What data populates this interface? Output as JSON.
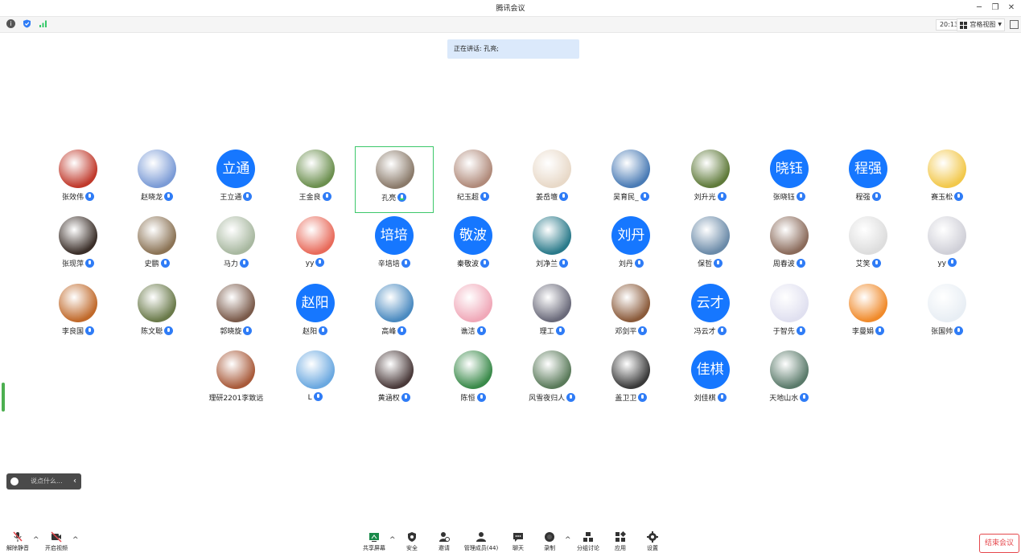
{
  "window": {
    "title": "腾讯会议",
    "timer": "20:13",
    "view_mode": "宫格视图"
  },
  "speaking": {
    "text": "正在讲话: 孔亮;"
  },
  "colors": {
    "accent_blue": "#2f7cf6",
    "active_border": "#3cc86a",
    "end_red": "#e5484d"
  },
  "participants": [
    {
      "name": "张效伟",
      "avatar": "photo",
      "color": "#c0392b"
    },
    {
      "name": "赵晓龙",
      "avatar": "photo",
      "color": "#7b9bd6"
    },
    {
      "name": "王立通",
      "avatar": "text",
      "initials": "立通",
      "color": "#1677ff"
    },
    {
      "name": "王金良",
      "avatar": "photo",
      "color": "#6b8f4e"
    },
    {
      "name": "孔亮",
      "avatar": "photo",
      "color": "#8a7a6a",
      "active": true
    },
    {
      "name": "纪玉超",
      "avatar": "photo",
      "color": "#b08a7a"
    },
    {
      "name": "姜岳壇",
      "avatar": "photo",
      "color": "#e8d9c8"
    },
    {
      "name": "吴育民_",
      "avatar": "photo",
      "color": "#4a7bb5"
    },
    {
      "name": "刘升光",
      "avatar": "photo",
      "color": "#5f7a3a"
    },
    {
      "name": "张晓钰",
      "avatar": "text",
      "initials": "晓钰",
      "color": "#1677ff"
    },
    {
      "name": "程强",
      "avatar": "text",
      "initials": "程强",
      "color": "#1677ff"
    },
    {
      "name": "赛玉松",
      "avatar": "photo",
      "color": "#f2c84b"
    },
    {
      "name": "张现萍",
      "avatar": "photo",
      "color": "#3a2e28"
    },
    {
      "name": "史鹏",
      "avatar": "photo",
      "color": "#8b7355"
    },
    {
      "name": "马力",
      "avatar": "photo",
      "color": "#a8b8a0"
    },
    {
      "name": "yy",
      "avatar": "photo",
      "color": "#e86a5a"
    },
    {
      "name": "辛培培",
      "avatar": "text",
      "initials": "培培",
      "color": "#1677ff"
    },
    {
      "name": "秦敬波",
      "avatar": "text",
      "initials": "敬波",
      "color": "#1677ff"
    },
    {
      "name": "刘净兰",
      "avatar": "photo",
      "color": "#2a7a8a"
    },
    {
      "name": "刘丹",
      "avatar": "text",
      "initials": "刘丹",
      "color": "#1677ff"
    },
    {
      "name": "保哲",
      "avatar": "photo",
      "color": "#6a8aa8"
    },
    {
      "name": "周春波",
      "avatar": "photo",
      "color": "#8a6a5a"
    },
    {
      "name": "艾笑",
      "avatar": "photo",
      "color": "#dddddd"
    },
    {
      "name": "yy",
      "avatar": "photo",
      "color": "#d0d0d8"
    },
    {
      "name": "李良国",
      "avatar": "photo",
      "color": "#c0692a"
    },
    {
      "name": "陈文聪",
      "avatar": "photo",
      "color": "#6a7a4a"
    },
    {
      "name": "郭晓旋",
      "avatar": "photo",
      "color": "#7a5a4a"
    },
    {
      "name": "赵阳",
      "avatar": "text",
      "initials": "赵阳",
      "color": "#1677ff"
    },
    {
      "name": "高峰",
      "avatar": "photo",
      "color": "#4a8ac0"
    },
    {
      "name": "谯洁",
      "avatar": "photo",
      "color": "#f0a8b8"
    },
    {
      "name": "理工",
      "avatar": "photo",
      "color": "#6a6a7a"
    },
    {
      "name": "邓剑平",
      "avatar": "photo",
      "color": "#8a5a3a"
    },
    {
      "name": "冯云才",
      "avatar": "text",
      "initials": "云才",
      "color": "#1677ff"
    },
    {
      "name": "于智先",
      "avatar": "photo",
      "color": "#e0e0f0"
    },
    {
      "name": "李曼娟",
      "avatar": "photo",
      "color": "#f08a2a"
    },
    {
      "name": "张国帅",
      "avatar": "photo",
      "color": "#e8eef4"
    },
    {
      "name": "理研2201李致远",
      "avatar": "photo",
      "color": "#a85a3a",
      "no_mic": true
    },
    {
      "name": "L",
      "avatar": "photo",
      "color": "#6aa8e0"
    },
    {
      "name": "黄涵权",
      "avatar": "photo",
      "color": "#4a3a3a"
    },
    {
      "name": "陈恒",
      "avatar": "photo",
      "color": "#3a8a4a"
    },
    {
      "name": "风雪夜归人",
      "avatar": "photo",
      "color": "#5a7a5a"
    },
    {
      "name": "盖卫卫",
      "avatar": "photo",
      "color": "#3a3a3a"
    },
    {
      "name": "刘佳棋",
      "avatar": "text",
      "initials": "佳棋",
      "color": "#1677ff"
    },
    {
      "name": "天地山水",
      "avatar": "photo",
      "color": "#5a7a6a"
    }
  ],
  "chat": {
    "placeholder": "说点什么..."
  },
  "bottom": {
    "unmute": "解除静音",
    "video": "开启视频",
    "share": "共享屏幕",
    "security": "安全",
    "invite": "邀请",
    "members": "管理成员(44)",
    "chat": "聊天",
    "record": "录制",
    "breakout": "分组讨论",
    "apps": "应用",
    "settings": "设置",
    "end": "结束会议"
  }
}
